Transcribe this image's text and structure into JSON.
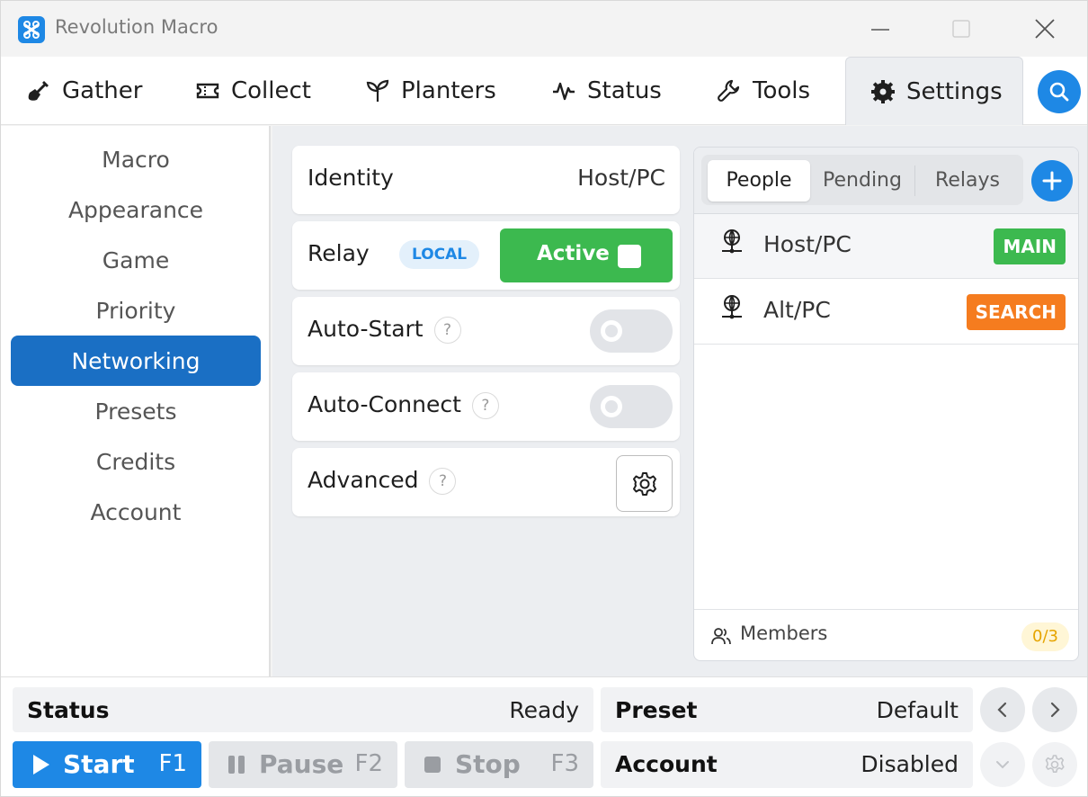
{
  "window": {
    "title": "Revolution Macro",
    "controls": {
      "minimize_icon": "minimize-icon",
      "maximize_icon": "maximize-icon",
      "close_icon": "close-icon"
    }
  },
  "nav": {
    "tabs": [
      {
        "label": "Gather",
        "icon": "shovel-icon"
      },
      {
        "label": "Collect",
        "icon": "ticket-icon"
      },
      {
        "label": "Planters",
        "icon": "sprout-icon"
      },
      {
        "label": "Status",
        "icon": "pulse-icon"
      },
      {
        "label": "Tools",
        "icon": "wrench-icon"
      },
      {
        "label": "Settings",
        "icon": "gear-icon",
        "active": true
      }
    ],
    "search_icon": "search-icon"
  },
  "sidebar": {
    "items": [
      {
        "label": "Macro"
      },
      {
        "label": "Appearance"
      },
      {
        "label": "Game"
      },
      {
        "label": "Priority"
      },
      {
        "label": "Networking",
        "active": true
      },
      {
        "label": "Presets"
      },
      {
        "label": "Credits"
      },
      {
        "label": "Account"
      }
    ]
  },
  "settings": {
    "identity": {
      "label": "Identity",
      "value": "Host/PC"
    },
    "relay": {
      "label": "Relay",
      "badge": "LOCAL",
      "button": "Active",
      "checked": true
    },
    "auto_start": {
      "label": "Auto-Start",
      "help": "?",
      "enabled": false
    },
    "auto_connect": {
      "label": "Auto-Connect",
      "help": "?",
      "enabled": false
    },
    "advanced": {
      "label": "Advanced",
      "help": "?"
    }
  },
  "network_panel": {
    "tabs": [
      {
        "label": "People",
        "active": true
      },
      {
        "label": "Pending"
      },
      {
        "label": "Relays"
      }
    ],
    "members": [
      {
        "name": "Host/PC",
        "role": "MAIN",
        "role_color": "#3cb94f"
      },
      {
        "name": "Alt/PC",
        "role": "SEARCH",
        "role_color": "#f57c1f"
      }
    ],
    "footer": {
      "label": "Members",
      "count": "0/3"
    }
  },
  "footer": {
    "status": {
      "label": "Status",
      "value": "Ready"
    },
    "preset": {
      "label": "Preset",
      "value": "Default"
    },
    "account": {
      "label": "Account",
      "value": "Disabled"
    },
    "start": {
      "label": "Start",
      "key": "F1"
    },
    "pause": {
      "label": "Pause",
      "key": "F2"
    },
    "stop": {
      "label": "Stop",
      "key": "F3"
    }
  },
  "colors": {
    "accent": "#1e88e5",
    "sidebar_active": "#1a6fc4",
    "active_green": "#3cb94f",
    "search_orange": "#f57c1f",
    "count_yellow": "#e6a400"
  }
}
